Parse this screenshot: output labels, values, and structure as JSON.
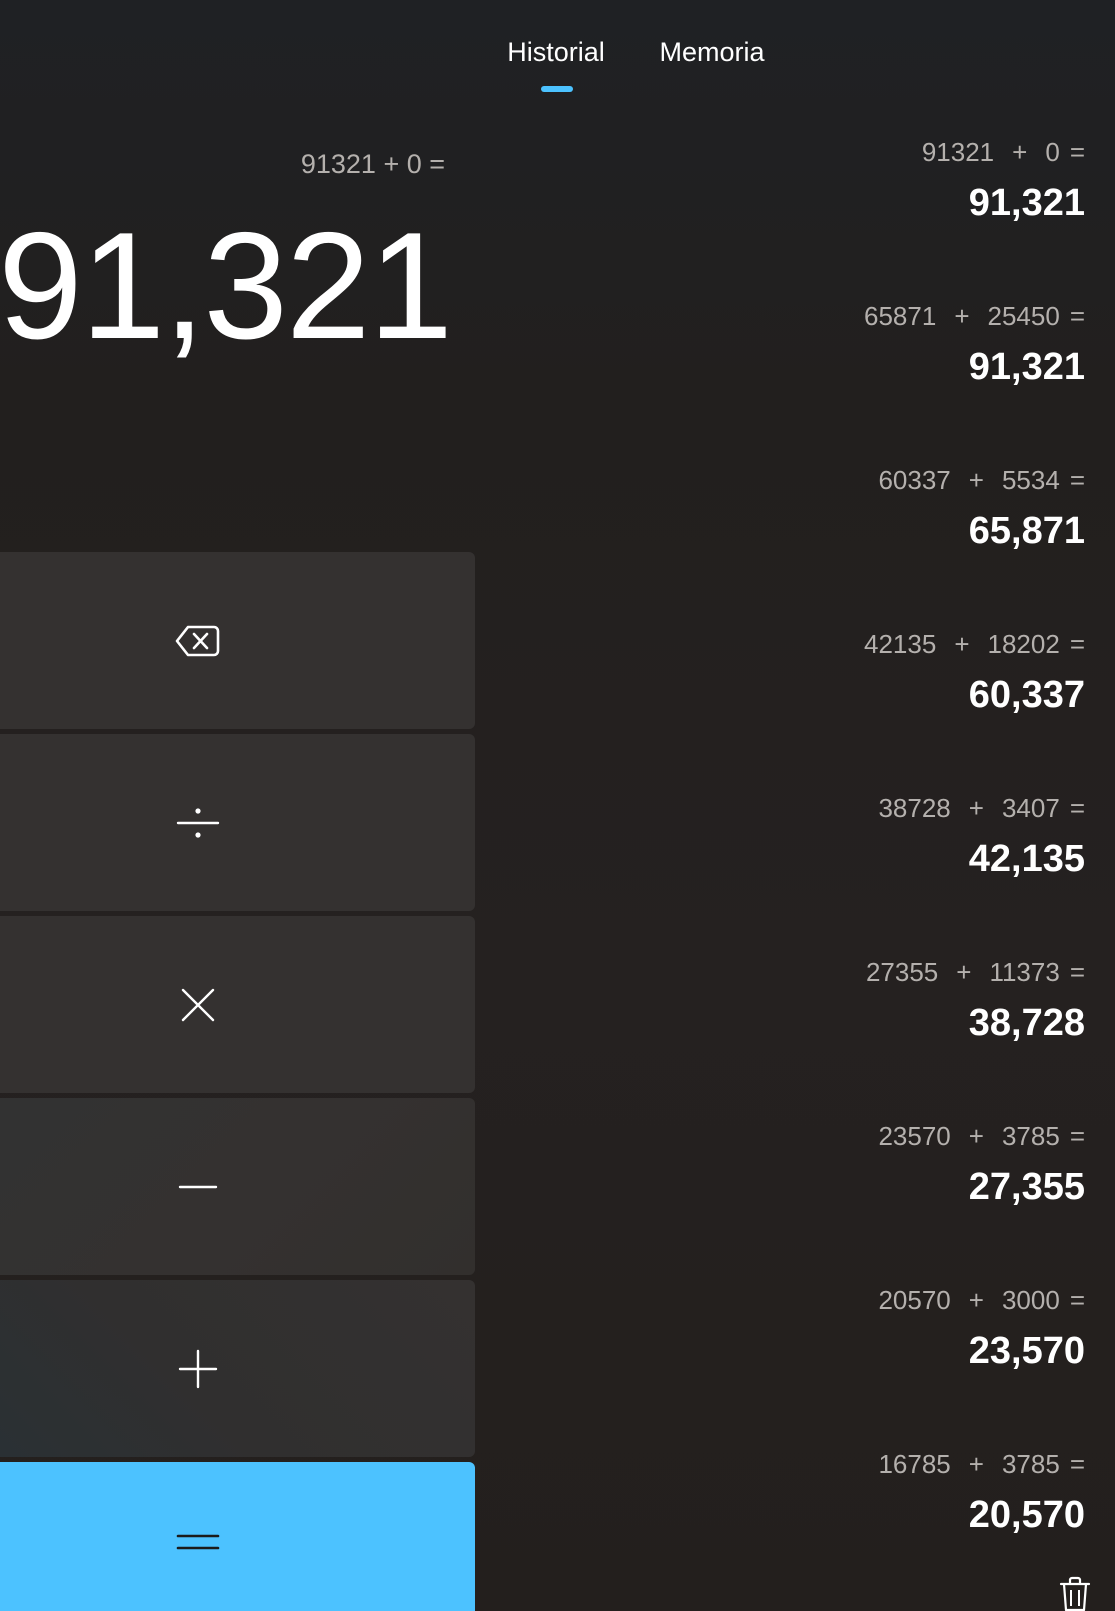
{
  "tabs": {
    "historial_label": "Historial",
    "memoria_label": "Memoria",
    "accent_color": "#4cc2ff"
  },
  "display": {
    "expression": "91321 + 0 =",
    "result": "91,321"
  },
  "keys": {
    "backspace_icon": "backspace-icon",
    "divide_icon": "divide-icon",
    "multiply_icon": "multiply-icon",
    "minus_icon": "minus-icon",
    "plus_icon": "plus-icon",
    "equals_icon": "equals-icon",
    "equals_color": "#4cc2ff"
  },
  "history": [
    {
      "a": "91321",
      "op": "+",
      "b": "0",
      "eq": "=",
      "result": "91,321"
    },
    {
      "a": "65871",
      "op": "+",
      "b": "25450",
      "eq": "=",
      "result": "91,321"
    },
    {
      "a": "60337",
      "op": "+",
      "b": "5534",
      "eq": "=",
      "result": "65,871"
    },
    {
      "a": "42135",
      "op": "+",
      "b": "18202",
      "eq": "=",
      "result": "60,337"
    },
    {
      "a": "38728",
      "op": "+",
      "b": "3407",
      "eq": "=",
      "result": "42,135"
    },
    {
      "a": "27355",
      "op": "+",
      "b": "11373",
      "eq": "=",
      "result": "38,728"
    },
    {
      "a": "23570",
      "op": "+",
      "b": "3785",
      "eq": "=",
      "result": "27,355"
    },
    {
      "a": "20570",
      "op": "+",
      "b": "3000",
      "eq": "=",
      "result": "23,570"
    },
    {
      "a": "16785",
      "op": "+",
      "b": "3785",
      "eq": "=",
      "result": "20,570"
    }
  ],
  "delete_history_icon": "trash-icon"
}
